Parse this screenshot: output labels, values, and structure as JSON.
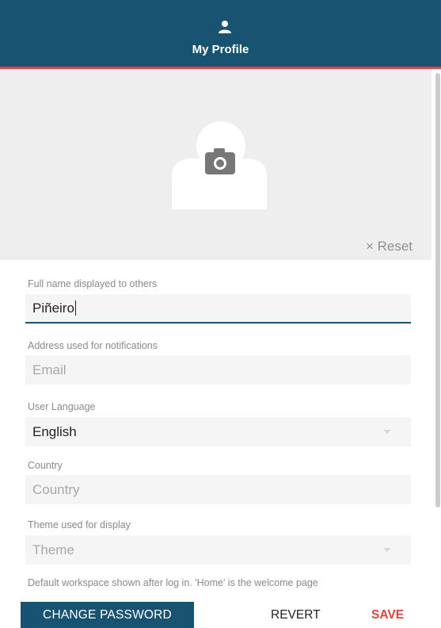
{
  "header": {
    "title": "My Profile",
    "icon": "person-icon",
    "background": "#185472",
    "accent": "#e0433f"
  },
  "avatar": {
    "icon": "camera-icon",
    "reset_label": "× Reset"
  },
  "form": {
    "full_name": {
      "label": "Full name displayed to others",
      "value": "Piñeiro"
    },
    "email": {
      "label": "Address used for notifications",
      "placeholder": "Email"
    },
    "language": {
      "label": "User Language",
      "value": "English"
    },
    "country": {
      "label": "Country",
      "placeholder": "Country"
    },
    "theme": {
      "label": "Theme used for display",
      "placeholder": "Theme"
    },
    "workspace": {
      "label": "Default workspace shown after log in. 'Home' is the welcome page"
    }
  },
  "footer": {
    "change_password_label": "CHANGE PASSWORD",
    "revert_label": "REVERT",
    "save_label": "SAVE"
  }
}
